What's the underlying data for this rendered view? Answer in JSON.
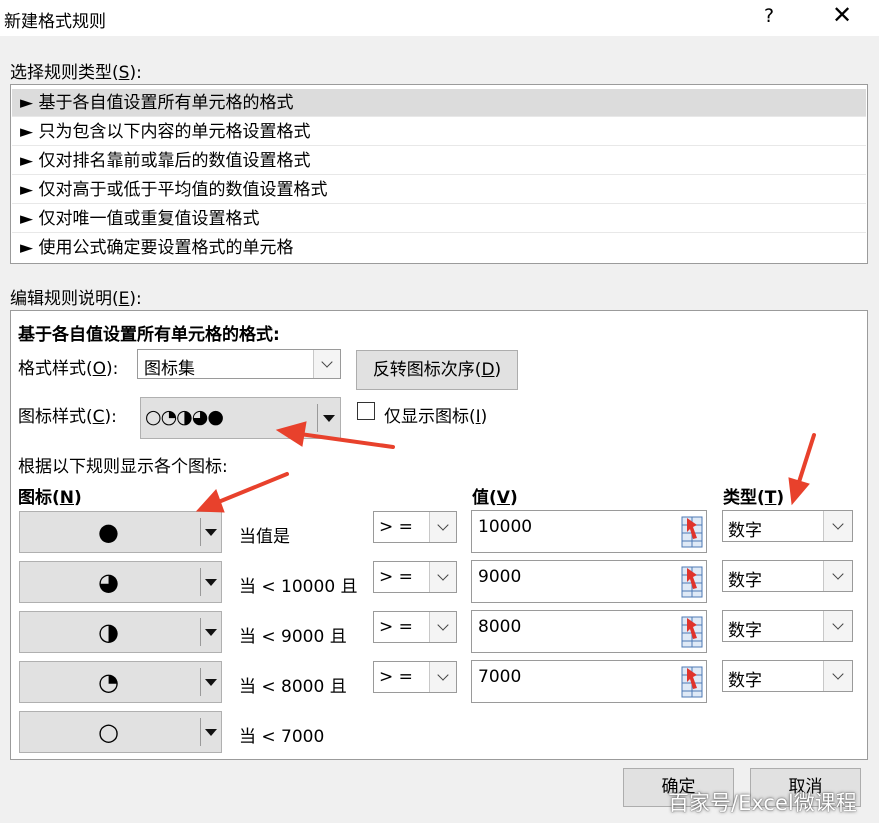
{
  "dialog": {
    "title": "新建格式规则",
    "help": "?",
    "close": "✕"
  },
  "rule_type": {
    "label": "选择规则类型(",
    "key": "S",
    "label_end": "):",
    "items": [
      "► 基于各自值设置所有单元格的格式",
      "► 只为包含以下内容的单元格设置格式",
      "► 仅对排名靠前或靠后的数值设置格式",
      "► 仅对高于或低于平均值的数值设置格式",
      "► 仅对唯一值或重复值设置格式",
      "► 使用公式确定要设置格式的单元格"
    ],
    "selected_index": 0
  },
  "edit": {
    "label": "编辑规则说明(",
    "key": "E",
    "label_end": "):",
    "heading": "基于各自值设置所有单元格的格式:",
    "format_style_label": "格式样式(",
    "format_style_key": "O",
    "format_style_end": "):",
    "format_style_value": "图标集",
    "reverse_btn_label": "反转图标次序(",
    "reverse_btn_key": "D",
    "reverse_btn_end": ")",
    "icon_style_label": "图标样式(",
    "icon_style_key": "C",
    "icon_style_end": "):",
    "icon_style_value": "○◔◑◕●",
    "show_icon_only_label": "仅显示图标(",
    "show_icon_only_key": "I",
    "show_icon_only_end": ")",
    "show_icon_only_checked": false,
    "rules_caption": "根据以下规则显示各个图标:",
    "col_icon": "图标(",
    "col_icon_key": "N",
    "col_icon_end": ")",
    "col_value": "值(",
    "col_value_key": "V",
    "col_value_end": ")",
    "col_type": "类型(",
    "col_type_key": "T",
    "col_type_end": ")",
    "rows": [
      {
        "icon": "full-circle-icon",
        "glyph": "●",
        "condition": "当值是",
        "operator": "> =",
        "value": "10000",
        "type": "数字"
      },
      {
        "icon": "three-quarter-circle-icon",
        "glyph": "◕",
        "condition": "当 < 10000 且",
        "operator": "> =",
        "value": "9000",
        "type": "数字"
      },
      {
        "icon": "half-circle-icon",
        "glyph": "◑",
        "condition": "当 < 9000 且",
        "operator": "> =",
        "value": "8000",
        "type": "数字"
      },
      {
        "icon": "quarter-circle-icon",
        "glyph": "◔",
        "condition": "当 < 8000 且",
        "operator": "> =",
        "value": "7000",
        "type": "数字"
      },
      {
        "icon": "empty-circle-icon",
        "glyph": "○",
        "condition": "当 < 7000"
      }
    ]
  },
  "buttons": {
    "ok": "确定",
    "cancel": "取消"
  },
  "watermark": "百家号/Excel微课程",
  "colors": {
    "annotation_arrow": "#e8412c",
    "selection": "#dcdcdc"
  }
}
